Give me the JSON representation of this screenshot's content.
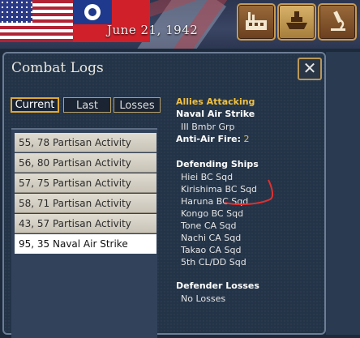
{
  "top": {
    "date": "June 21, 1942"
  },
  "dialog": {
    "title": "Combat Logs",
    "tabs": [
      "Current",
      "Last",
      "Losses"
    ],
    "list": [
      "55, 78 Partisan Activity",
      "56, 80 Partisan Activity",
      "57, 75 Partisan Activity",
      "58, 71 Partisan Activity",
      "43, 57 Partisan Activity",
      "95, 35 Naval Air Strike"
    ],
    "details": {
      "attacker_header": "Allies Attacking",
      "event_type": "Naval Air Strike",
      "attacker_unit": "III Bmbr Grp",
      "aa_label": "Anti-Air Fire:",
      "aa_value": "2",
      "defending_header": "Defending Ships",
      "ships": [
        "Hiei BC Sqd",
        "Kirishima BC Sqd",
        "Haruna BC Sqd",
        "Kongo BC Sqd",
        "Tone CA Sqd",
        "Nachi CA Sqd",
        "Takao CA Sqd",
        "5th CL/DD Sqd"
      ],
      "losses_header": "Defender Losses",
      "losses_value": "No Losses"
    }
  },
  "icons": [
    "factory-icon",
    "ship-icon",
    "microscope-icon",
    "close-icon"
  ],
  "colors": {
    "accent": "#e0a830",
    "attacker_header": "#f0c040",
    "panel_bg": "#243448"
  }
}
